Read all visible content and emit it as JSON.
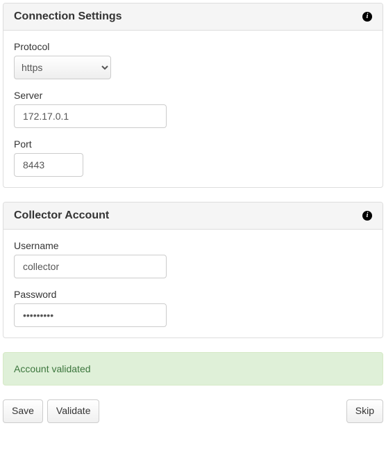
{
  "connection": {
    "title": "Connection Settings",
    "protocol_label": "Protocol",
    "protocol_value": "https",
    "server_label": "Server",
    "server_value": "172.17.0.1",
    "port_label": "Port",
    "port_value": "8443"
  },
  "account": {
    "title": "Collector Account",
    "username_label": "Username",
    "username_value": "collector",
    "password_label": "Password",
    "password_value": "•••••••••"
  },
  "status": {
    "message": "Account validated"
  },
  "buttons": {
    "save": "Save",
    "validate": "Validate",
    "skip": "Skip"
  },
  "icons": {
    "info": "i"
  }
}
